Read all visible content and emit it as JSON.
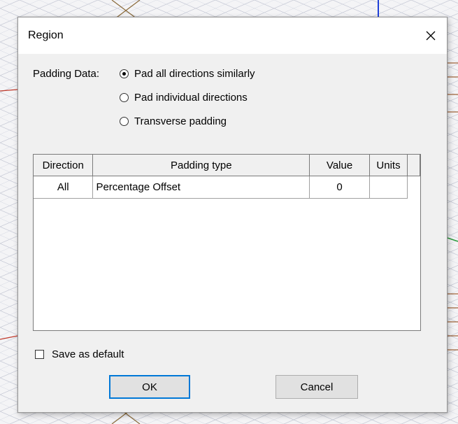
{
  "window": {
    "title": "Region"
  },
  "padding": {
    "label": "Padding Data:",
    "options": [
      {
        "label": "Pad all directions similarly",
        "selected": true
      },
      {
        "label": "Pad individual directions",
        "selected": false
      },
      {
        "label": "Transverse padding",
        "selected": false
      }
    ]
  },
  "table": {
    "headers": [
      "Direction",
      "Padding type",
      "Value",
      "Units"
    ],
    "rows": [
      {
        "direction": "All",
        "padding_type": "Percentage Offset",
        "value": "0",
        "units": ""
      }
    ]
  },
  "save_default": {
    "label": "Save as default",
    "checked": false
  },
  "buttons": {
    "ok": "OK",
    "cancel": "Cancel"
  },
  "icons": {
    "close": "close-icon"
  }
}
